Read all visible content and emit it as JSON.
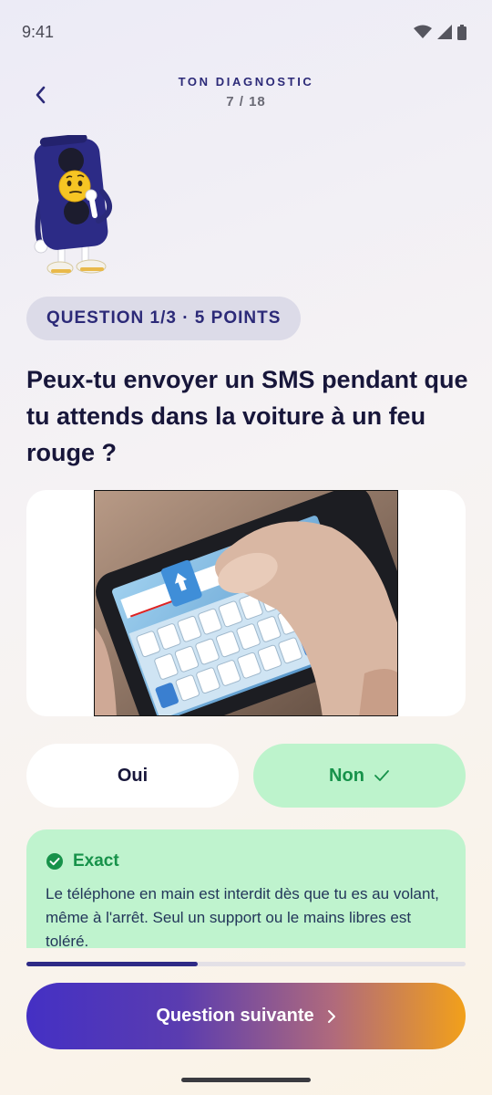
{
  "status_bar": {
    "time": "9:41"
  },
  "header": {
    "title": "TON DIAGNOSTIC",
    "progress": "7 / 18"
  },
  "question": {
    "badge": "QUESTION 1/3 · 5 POINTS",
    "text": "Peux-tu envoyer un SMS pendant que tu attends dans la voiture à un feu rouge ?"
  },
  "answers": {
    "oui": "Oui",
    "non": "Non"
  },
  "feedback": {
    "title": "Exact",
    "text": "Le téléphone en main est interdit dès que tu es au volant, même à l'arrêt. Seul un support ou le mains libres est toléré."
  },
  "progress": {
    "value": 0.39
  },
  "next_button": {
    "label": "Question suivante"
  },
  "colors": {
    "primary": "#2c2a78",
    "correct_green": "#16924a",
    "correct_bg": "#bdf3cc",
    "gradient_start": "#4430c4",
    "gradient_end": "#f2a01a"
  },
  "icons": {
    "back": "chevron-left-icon",
    "check": "check-icon",
    "check_circle": "check-circle-icon",
    "next": "chevron-right-icon",
    "wifi": "wifi-icon",
    "signal": "signal-icon",
    "battery": "battery-icon"
  }
}
